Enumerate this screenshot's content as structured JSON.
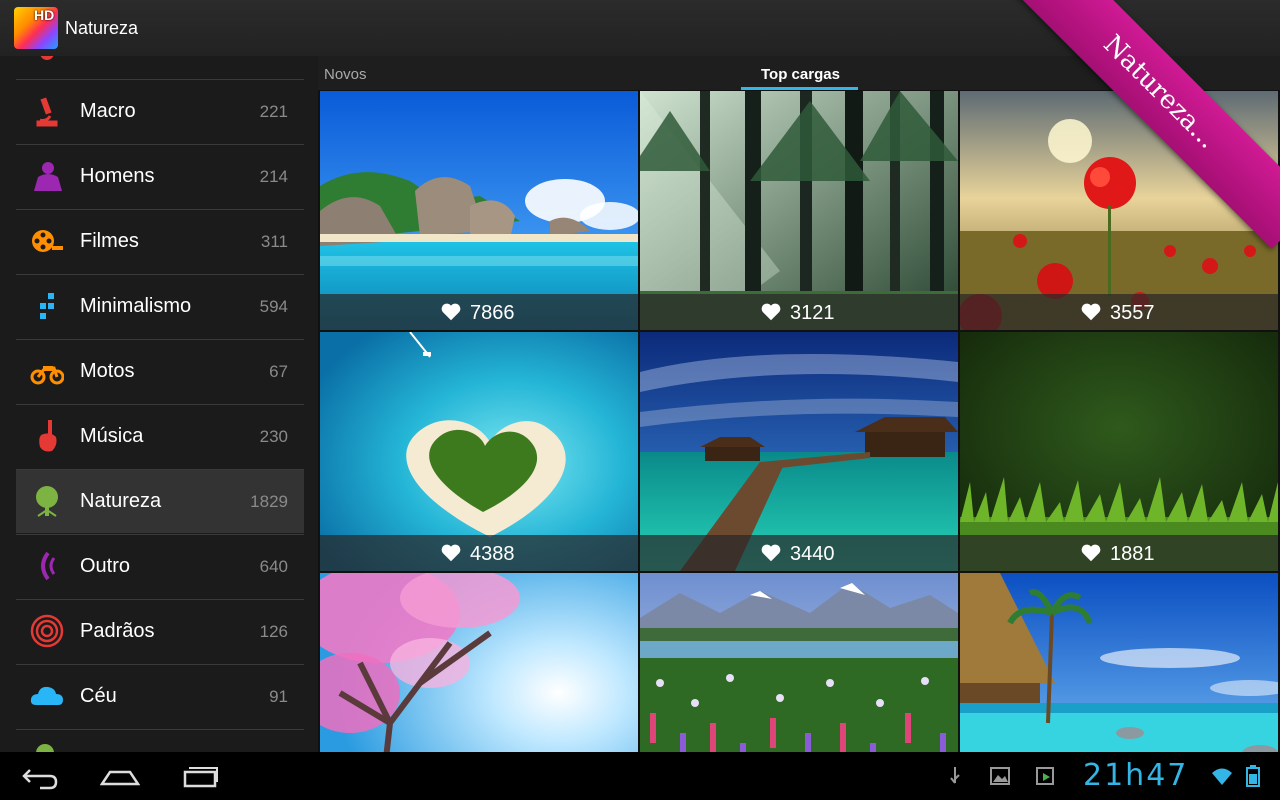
{
  "app": {
    "title": "Natureza",
    "logo_badge": "HD"
  },
  "sidebar": {
    "items": [
      {
        "label": "Macro",
        "count": "221",
        "icon": "microscope-icon",
        "color": "#e53935"
      },
      {
        "label": "Homens",
        "count": "214",
        "icon": "man-icon",
        "color": "#9c27b0"
      },
      {
        "label": "Filmes",
        "count": "311",
        "icon": "film-reel-icon",
        "color": "#ff8f00"
      },
      {
        "label": "Minimalismo",
        "count": "594",
        "icon": "dots-icon",
        "color": "#29b6f6"
      },
      {
        "label": "Motos",
        "count": "67",
        "icon": "motorcycle-icon",
        "color": "#ff8f00"
      },
      {
        "label": "Música",
        "count": "230",
        "icon": "guitar-icon",
        "color": "#e53935"
      },
      {
        "label": "Natureza",
        "count": "1829",
        "icon": "tree-icon",
        "color": "#7cb342",
        "active": true
      },
      {
        "label": "Outro",
        "count": "640",
        "icon": "signal-icon",
        "color": "#9c27b0"
      },
      {
        "label": "Padrãos",
        "count": "126",
        "icon": "spiral-icon",
        "color": "#e53935"
      },
      {
        "label": "Céu",
        "count": "91",
        "icon": "cloud-icon",
        "color": "#29b6f6"
      }
    ]
  },
  "tabs": {
    "new_label": "Novos",
    "top_label": "Top cargas",
    "accent": "#33b5e5"
  },
  "grid": {
    "tiles": [
      {
        "likes": "7866",
        "scene": "beach-rocks"
      },
      {
        "likes": "3121",
        "scene": "forest"
      },
      {
        "likes": "3557",
        "scene": "poppy-field"
      },
      {
        "likes": "4388",
        "scene": "heart-island"
      },
      {
        "likes": "3440",
        "scene": "pier-bungalows"
      },
      {
        "likes": "1881",
        "scene": "grass-dew"
      },
      {
        "likes": "",
        "scene": "pink-tree"
      },
      {
        "likes": "",
        "scene": "mountain-flowers"
      },
      {
        "likes": "",
        "scene": "tropical-pool"
      }
    ]
  },
  "ribbon": {
    "label": "Natureza...",
    "color": "#c0167f"
  },
  "statusbar": {
    "clock": "21h47"
  }
}
